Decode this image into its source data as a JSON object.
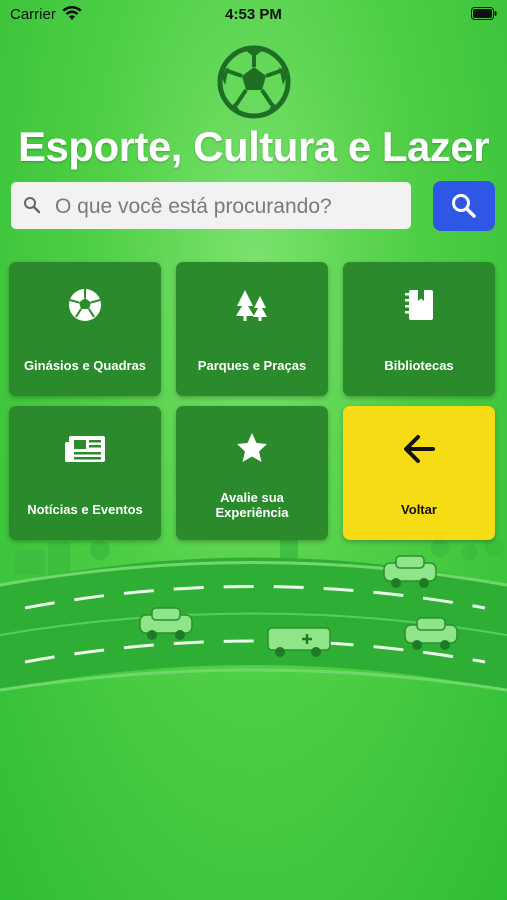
{
  "status_bar": {
    "carrier": "Carrier",
    "time": "4:53 PM"
  },
  "header": {
    "title": "Esporte, Cultura e Lazer"
  },
  "search": {
    "placeholder": "O que você está procurando?"
  },
  "tiles": [
    {
      "label": "Ginásios e Quadras",
      "icon": "soccer-ball-icon"
    },
    {
      "label": "Parques e Praças",
      "icon": "trees-icon"
    },
    {
      "label": "Bibliotecas",
      "icon": "book-icon"
    },
    {
      "label": "Notícias e Eventos",
      "icon": "newspaper-icon"
    },
    {
      "label": "Avalie sua Experiência",
      "icon": "star-icon"
    },
    {
      "label": "Voltar",
      "icon": "arrow-left-icon"
    }
  ],
  "colors": {
    "tile": "#2b8a2c",
    "back_tile": "#f6dc14",
    "search_button": "#2f57e6",
    "background": "#4fcf45"
  }
}
